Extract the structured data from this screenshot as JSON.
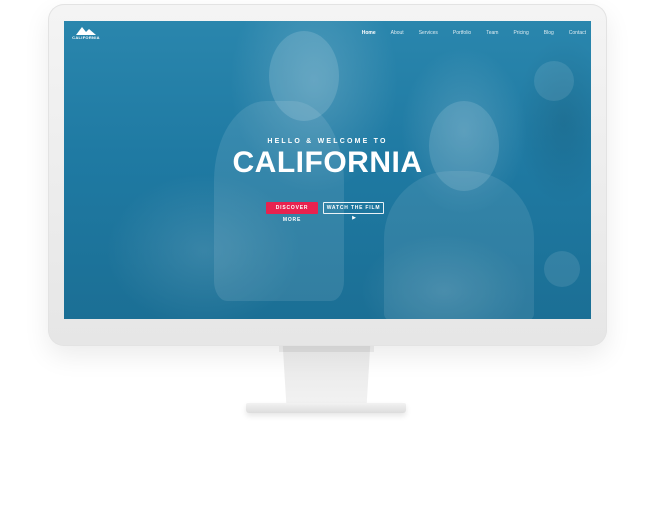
{
  "brand": {
    "logo_text": "CALIFORNIA"
  },
  "nav": {
    "items": [
      {
        "label": "Home",
        "active": true
      },
      {
        "label": "About",
        "active": false
      },
      {
        "label": "Services",
        "active": false
      },
      {
        "label": "Portfolio",
        "active": false
      },
      {
        "label": "Team",
        "active": false
      },
      {
        "label": "Pricing",
        "active": false
      },
      {
        "label": "Blog",
        "active": false
      },
      {
        "label": "Contact",
        "active": false
      }
    ]
  },
  "hero": {
    "subtitle": "HELLO & WELCOME TO",
    "title": "CALIFORNIA",
    "primary_button": "DISCOVER MORE",
    "secondary_button": "WATCH THE FILM",
    "secondary_icon": "play-icon"
  },
  "colors": {
    "overlay": "#1c7196",
    "accent": "#e8224f",
    "frame": "#eeeeee"
  }
}
